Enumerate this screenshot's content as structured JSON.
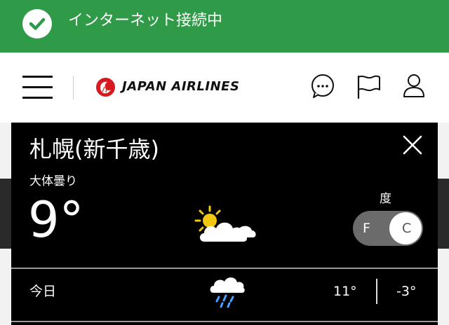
{
  "status_bar": {
    "message": "インターネット接続中",
    "icon": "check-circle-icon",
    "color": "#2f9a47"
  },
  "header": {
    "menu_icon": "hamburger-menu-icon",
    "brand": "JAPAN AIRLINES",
    "brand_logo": "jal-crane-logo",
    "brand_color": "#d71920",
    "actions": [
      {
        "icon": "chat-bubble-icon"
      },
      {
        "icon": "flag-icon"
      },
      {
        "icon": "user-icon"
      }
    ]
  },
  "weather": {
    "city": "札幌(新千歳)",
    "condition": "大体曇り",
    "temperature": "9°",
    "current_icon": "partly-sunny-icon",
    "unit_label": "度",
    "unit_options": [
      "F",
      "C"
    ],
    "selected_unit": "C",
    "close_icon": "close-icon",
    "forecast": [
      {
        "day": "今日",
        "icon": "rain-icon",
        "high": "11°",
        "low": "-3°"
      }
    ]
  }
}
